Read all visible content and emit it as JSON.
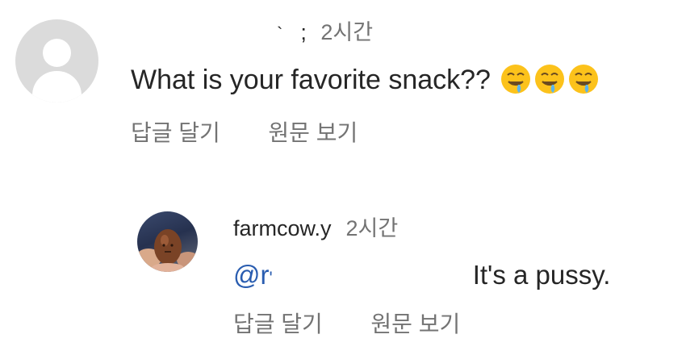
{
  "comments": [
    {
      "username_fragment": "; ",
      "time": "2시간",
      "text": "What is your favorite snack??",
      "emoji_count": 3,
      "emoji_icon": "drooling-face-icon",
      "reply_label": "답글 달기",
      "translate_label": "원문 보기"
    }
  ],
  "reply": {
    "username": "farmcow.y",
    "time": "2시간",
    "mention": "@r",
    "text": "It's a pussy.",
    "reply_label": "답글 달기",
    "translate_label": "원문 보기"
  },
  "colors": {
    "text": "#262626",
    "secondary": "#737373",
    "mention": "#2a5db0",
    "avatar_default": "#dbdbdb"
  }
}
